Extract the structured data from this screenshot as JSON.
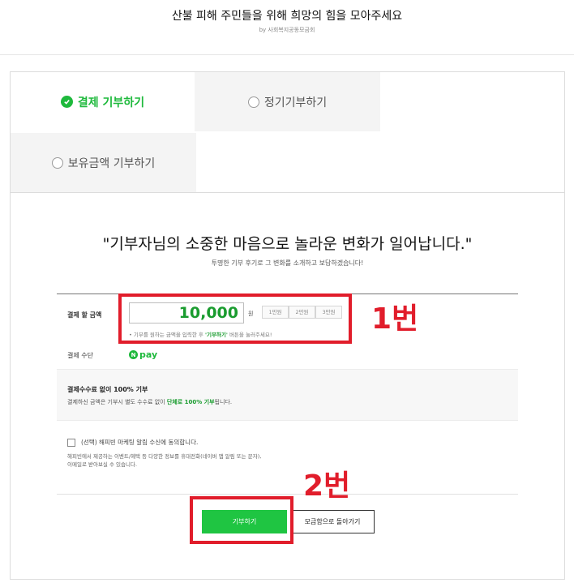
{
  "header": {
    "title": "산불 피해 주민들을 위해 희망의 힘을 모아주세요",
    "by": "by 사회복지공동모금회"
  },
  "tabs": [
    {
      "label": "결제 기부하기"
    },
    {
      "label": "정기기부하기"
    },
    {
      "label": "보유금액 기부하기"
    }
  ],
  "intro": {
    "headline": "\"기부자님의 소중한 마음으로 놀라운 변화가 일어납니다.\"",
    "subline": "투명한 기부 후기로 그 변화를 소개하고 보답하겠습니다!"
  },
  "form": {
    "amount_label": "결제 할 금액",
    "amount_value": "10,000",
    "currency": "원",
    "quick_amounts": [
      "1만원",
      "2만원",
      "3만원"
    ],
    "hint_pre": "• 기부를 원하는 금액을 입력한 후 ",
    "hint_strong": "'기부하기'",
    "hint_post": " 버튼을 눌러주세요!",
    "method_label": "결제 수단",
    "method_value": "pay",
    "method_badge": "N",
    "fee_title": "결제수수료 없이 100% 기부",
    "fee_desc_pre": "결제하신 금액은 기부시 별도 수수료 없이 ",
    "fee_desc_strong": "단체로 100% 기부",
    "fee_desc_post": "됩니다.",
    "agree_label": "(선택) 해피빈 마케팅 알림 수신에 동의합니다.",
    "agree_desc_line1": "해피빈에서 제공하는 이벤트/혜택 등 다양한 정보를 휴대전화(네이버 앱 알림 또는 문자),",
    "agree_desc_line2": "이메일로 받아보실 수 있습니다."
  },
  "buttons": {
    "donate": "기부하기",
    "back": "모금함으로 돌아가기"
  },
  "annotations": {
    "first": "1번",
    "second": "2번"
  },
  "colors": {
    "accent": "#1eb93c",
    "annotation": "#e11d2b"
  }
}
